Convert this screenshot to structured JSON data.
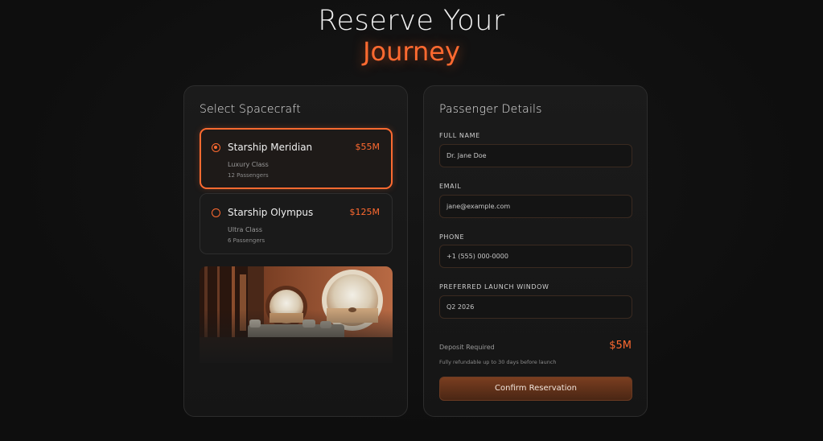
{
  "header": {
    "title_line1": "Reserve Your",
    "title_line2": "Journey"
  },
  "colors": {
    "accent": "#ff6a30",
    "background": "#101010",
    "card": "#1a1a1a"
  },
  "spacecraft": {
    "title": "Select Spacecraft",
    "options": [
      {
        "name": "Starship Meridian",
        "price": "$55M",
        "class": "Luxury Class",
        "passengers": "12 Passengers",
        "selected": true
      },
      {
        "name": "Starship Olympus",
        "price": "$125M",
        "class": "Ultra Class",
        "passengers": "6 Passengers",
        "selected": false
      }
    ],
    "image_icon": "spacecraft-interior-image"
  },
  "passenger": {
    "title": "Passenger Details",
    "fields": [
      {
        "label": "FULL NAME",
        "value": "Dr. Jane Doe"
      },
      {
        "label": "EMAIL",
        "value": "jane@example.com"
      },
      {
        "label": "PHONE",
        "value": "+1 (555) 000-0000"
      },
      {
        "label": "PREFERRED LAUNCH WINDOW",
        "value": "Q2 2026"
      }
    ],
    "deposit_label": "Deposit Required",
    "deposit_value": "$5M",
    "deposit_note": "Fully refundable up to 30 days before launch",
    "confirm_label": "Confirm Reservation"
  }
}
